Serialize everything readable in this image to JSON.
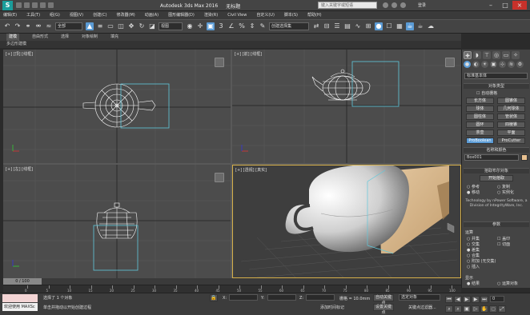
{
  "titlebar": {
    "app_title": "Autodesk 3ds Max 2016",
    "doc_title": "无标题",
    "search_placeholder": "键入关键字或短语",
    "user": "登录",
    "logo_text": "S"
  },
  "menubar": [
    "编辑(E)",
    "工具(T)",
    "组(G)",
    "视图(V)",
    "创建(C)",
    "修改器(M)",
    "动画(A)",
    "图形编辑器(D)",
    "渲染(R)",
    "Civil View",
    "自定义(U)",
    "脚本(S)",
    "帮助(H)"
  ],
  "toolbar": {
    "selection_filter": "全部",
    "ref_coord": "视图",
    "named_selection": "创建选择集"
  },
  "ribbon": {
    "tabs": [
      "建模",
      "自由形式",
      "选择",
      "对象绘制",
      "填充"
    ],
    "active_tab": "建模",
    "sub_label": "多边形建模"
  },
  "viewports": {
    "top_label": "[+] [顶] [线框]",
    "front_label": "[+] [前] [线框]",
    "left_label": "[+] [左] [线框]",
    "persp_label": "[+] [透视] [真实]"
  },
  "command_panel": {
    "dropdown": "标准基本体",
    "object_type_header": "对象类型",
    "autogrid": "自动栅格",
    "buttons": [
      "长方体",
      "圆锥体",
      "球体",
      "几何球体",
      "圆柱体",
      "管状体",
      "圆环",
      "四棱锥",
      "茶壶",
      "平面",
      "ProBoolean",
      "ProCutter"
    ],
    "active_button": "ProBoolean",
    "name_color_header": "名称和颜色",
    "object_name": "Box001",
    "pick_boolean_header": "拾取布尔对象",
    "start_pick": "开始拾取",
    "pick_options": [
      "参考",
      "复制",
      "移动",
      "实例化"
    ],
    "info_text": "Technology by nPower Software, a Division of IntegrityWare, Inc.",
    "params_header": "参数",
    "ops_label": "运算",
    "ops": [
      "并集",
      "交集",
      "差集",
      "合集",
      "附加 (无交集)",
      "插入"
    ],
    "ops_right": [
      "盖印",
      "切面"
    ],
    "display_label": "显示",
    "display_opts": [
      "结果",
      "运算对象"
    ]
  },
  "timeline": {
    "slider": "0 / 100",
    "ticks": [
      "0",
      "5",
      "10",
      "15",
      "20",
      "25",
      "30",
      "35",
      "40",
      "45",
      "50",
      "55",
      "60",
      "65",
      "70",
      "75",
      "80",
      "85",
      "90",
      "95",
      "100"
    ]
  },
  "status": {
    "maxscript": "",
    "welcome": "欢迎使用 MAXSc",
    "selected": "选择了 1 个对象",
    "prompt": "单击并拖动以开始创建过程",
    "x_label": "X:",
    "y_label": "Y:",
    "z_label": "Z:",
    "grid": "栅格 = 10.0mm",
    "add_time_tag": "添加时间标记",
    "auto_key": "自动关键点",
    "selected_obj": "选定对象",
    "set_key": "设置关键点",
    "key_filters": "关键点过滤器...",
    "frame": "0"
  },
  "colors": {
    "accent": "#5b9bd5",
    "selection_box": "#5fc8dc",
    "active_viewport": "#d6b04a",
    "box_color": "#d9b88c"
  }
}
